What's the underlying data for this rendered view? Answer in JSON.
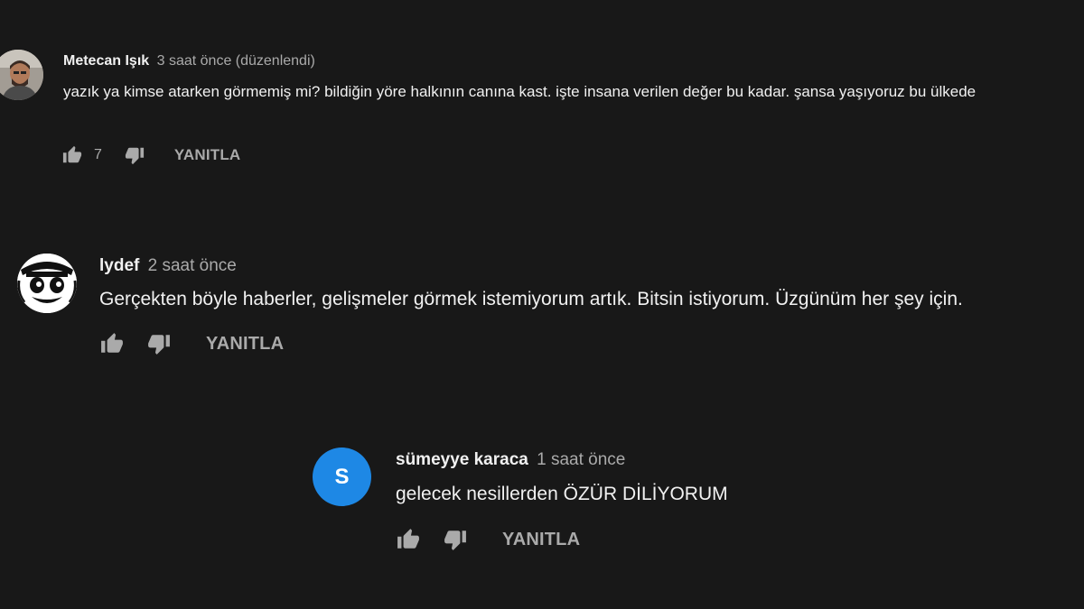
{
  "comments": [
    {
      "author": "Metecan Işık",
      "time": "3 saat önce (düzenlendi)",
      "text": "yazık ya kimse atarken görmemiş mi? bildiğin yöre halkının canına kast. işte insana verilen değer bu kadar. şansa yaşıyoruz bu ülkede",
      "likes": "7",
      "reply_label": "YANITLA",
      "avatar": "photo"
    },
    {
      "author": "lydef",
      "time": "2 saat önce",
      "text": "Gerçekten böyle haberler, gelişmeler görmek istemiyorum artık. Bitsin istiyorum. Üzgünüm her şey için.",
      "likes": "",
      "reply_label": "YANITLA",
      "avatar": "cartoon-face"
    },
    {
      "author": "sümeyye karaca",
      "time": "1 saat önce",
      "text": "gelecek nesillerden ÖZÜR DİLİYORUM",
      "likes": "",
      "reply_label": "YANITLA",
      "avatar_letter": "S",
      "avatar_color": "#1e88e5"
    }
  ],
  "colors": {
    "background": "#181818",
    "text": "#f1f1f1",
    "secondary": "#aaaaaa"
  }
}
